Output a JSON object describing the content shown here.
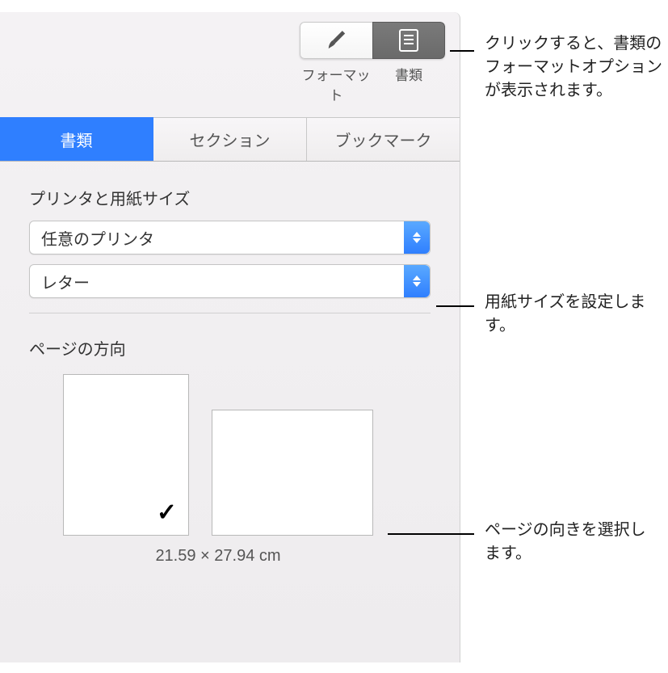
{
  "toolbar": {
    "format_label": "フォーマット",
    "document_label": "書類"
  },
  "tabs": {
    "document": "書類",
    "section": "セクション",
    "bookmark": "ブックマーク"
  },
  "sections": {
    "printer_paper_title": "プリンタと用紙サイズ",
    "printer_value": "任意のプリンタ",
    "paper_value": "レター",
    "orientation_title": "ページの方向",
    "page_size": "21.59 × 27.94 cm"
  },
  "callouts": {
    "document_button": "クリックすると、書類のフォーマットオプションが表示されます。",
    "paper_size": "用紙サイズを設定します。",
    "orientation": "ページの向きを選択します。"
  }
}
